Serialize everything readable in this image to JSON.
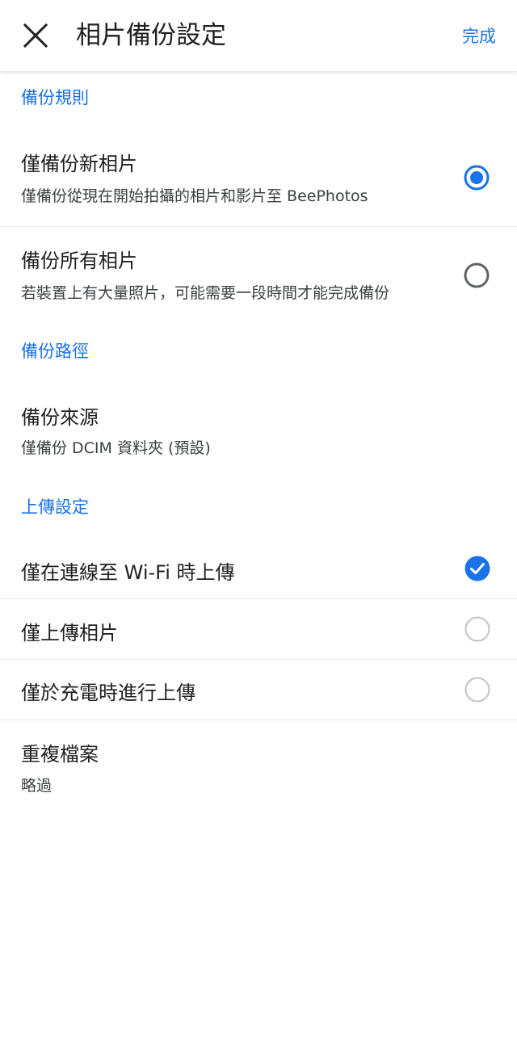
{
  "header": {
    "title": "相片備份設定",
    "done_label": "完成",
    "close_icon": "close-icon"
  },
  "colors": {
    "accent": "#1a73e8",
    "radio_selected": "#1a73e8",
    "radio_unselected": "#5f6368",
    "checkbox_unchecked": "#c4c4c4",
    "text_primary": "#202124",
    "divider": "#ececec"
  },
  "backup_rules": {
    "header": "備份規則",
    "options": [
      {
        "title": "僅備份新相片",
        "subtitle": "僅備份從現在開始拍攝的相片和影片至 BeePhotos",
        "selected": true
      },
      {
        "title": "備份所有相片",
        "subtitle": "若裝置上有大量照片，可能需要一段時間才能完成備份",
        "selected": false
      }
    ]
  },
  "backup_path": {
    "header": "備份路徑",
    "source_title": "備份來源",
    "source_value": "僅備份 DCIM 資料夾 (預設)"
  },
  "upload_settings": {
    "header": "上傳設定",
    "options": [
      {
        "label": "僅在連線至 Wi-Fi 時上傳",
        "checked": true
      },
      {
        "label": "僅上傳相片",
        "checked": false
      },
      {
        "label": "僅於充電時進行上傳",
        "checked": false
      }
    ]
  },
  "duplicates": {
    "title": "重複檔案",
    "value": "略過"
  }
}
